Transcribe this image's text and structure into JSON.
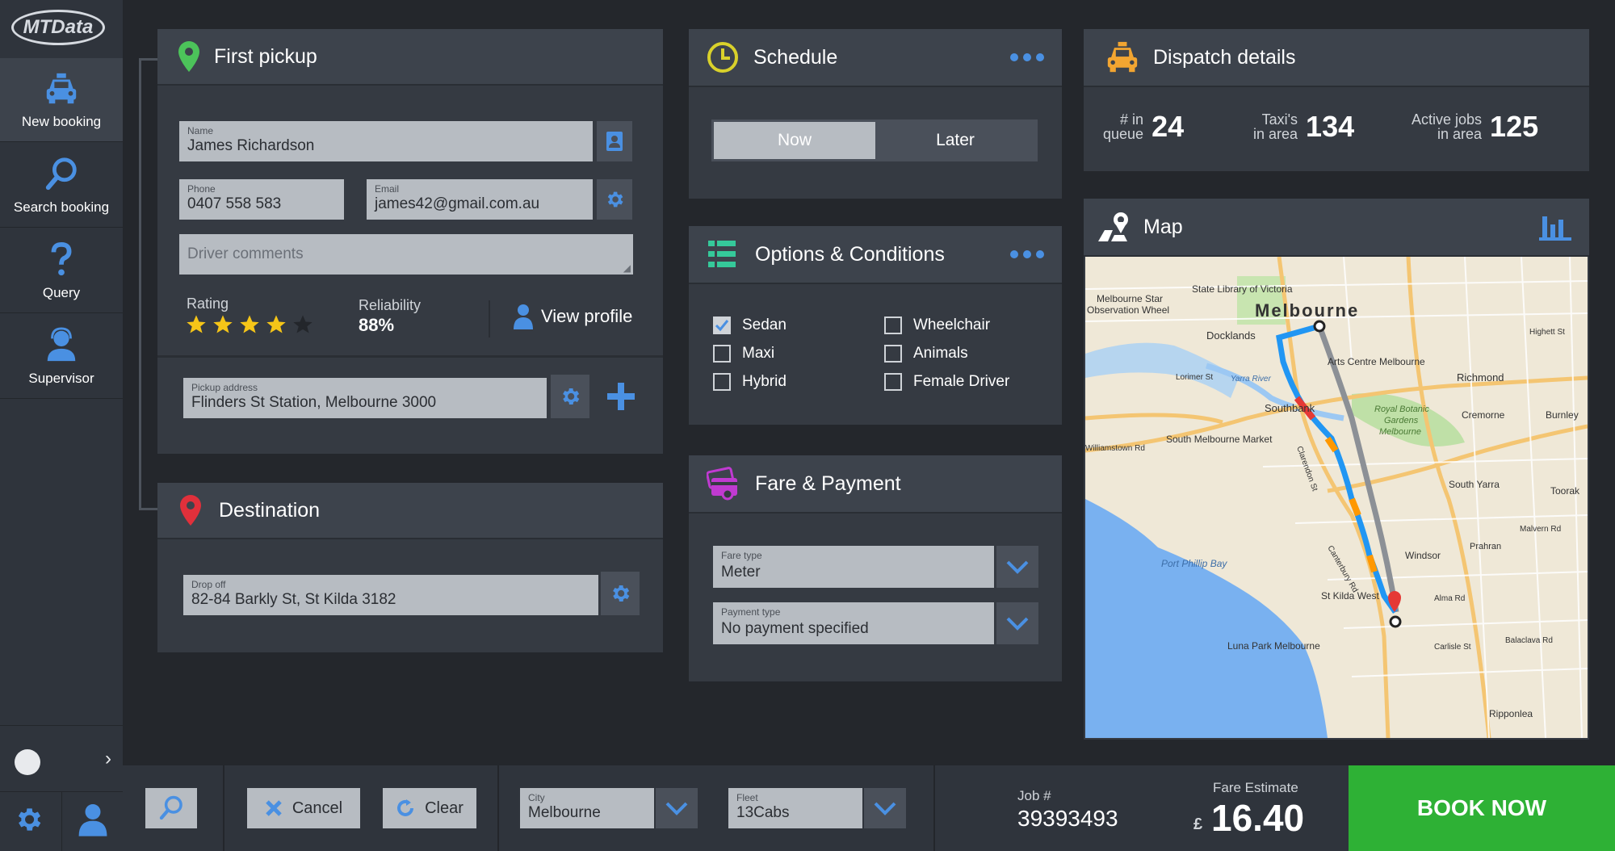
{
  "sidebar": {
    "logo": "MTData",
    "items": [
      {
        "label": "New booking",
        "icon": "taxi-icon"
      },
      {
        "label": "Search booking",
        "icon": "search-icon"
      },
      {
        "label": "Query",
        "icon": "question-icon"
      },
      {
        "label": "Supervisor",
        "icon": "supervisor-icon"
      }
    ]
  },
  "pickup": {
    "title": "First pickup",
    "name_label": "Name",
    "name_value": "James Richardson",
    "phone_label": "Phone",
    "phone_value": "0407 558 583",
    "email_label": "Email",
    "email_value": "james42@gmail.com.au",
    "comments_placeholder": "Driver comments",
    "rating_label": "Rating",
    "rating_stars": 4,
    "rating_max": 5,
    "reliability_label": "Reliability",
    "reliability_value": "88%",
    "view_profile": "View profile",
    "address_label": "Pickup address",
    "address_value": "Flinders St Station, Melbourne 3000"
  },
  "destination": {
    "title": "Destination",
    "dropoff_label": "Drop off",
    "dropoff_value": "82-84 Barkly St, St Kilda 3182"
  },
  "schedule": {
    "title": "Schedule",
    "now": "Now",
    "later": "Later",
    "selected": "Now"
  },
  "options": {
    "title": "Options & Conditions",
    "items": [
      {
        "label": "Sedan",
        "checked": true
      },
      {
        "label": "Maxi",
        "checked": false
      },
      {
        "label": "Hybrid",
        "checked": false
      },
      {
        "label": "Wheelchair",
        "checked": false
      },
      {
        "label": "Animals",
        "checked": false
      },
      {
        "label": "Female Driver",
        "checked": false
      }
    ]
  },
  "fare": {
    "title": "Fare & Payment",
    "fare_type_label": "Fare type",
    "fare_type_value": "Meter",
    "payment_type_label": "Payment type",
    "payment_type_value": "No payment specified"
  },
  "dispatch": {
    "title": "Dispatch details",
    "queue_label_1": "# in",
    "queue_label_2": "queue",
    "queue_value": "24",
    "taxis_label_1": "Taxi's",
    "taxis_label_2": "in area",
    "taxis_value": "134",
    "jobs_label_1": "Active jobs",
    "jobs_label_2": "in area",
    "jobs_value": "125"
  },
  "map": {
    "title": "Map",
    "labels": {
      "melbourne": "Melbourne",
      "state_library": "State Library of Victoria",
      "star": "Melbourne Star",
      "wheel": "Observation Wheel",
      "docklands": "Docklands",
      "arts": "Arts Centre Melbourne",
      "richmond": "Richmond",
      "southbank": "Southbank",
      "botanic1": "Royal Botanic",
      "botanic2": "Gardens",
      "botanic3": "Melbourne",
      "cremorne": "Cremorne",
      "burnley": "Burnley",
      "smm": "South Melbourne Market",
      "williamstown": "Williamstown Rd",
      "south_yarra": "South Yarra",
      "toorak": "Toorak",
      "windsor": "Windsor",
      "prahran": "Prahran",
      "port_phillip": "Port Phillip Bay",
      "st_kilda_west": "St Kilda West",
      "luna_park": "Luna Park Melbourne",
      "ripponlea": "Ripponlea",
      "alma": "Alma Rd",
      "balaclava": "Balaclava Rd",
      "carlisle": "Carlisle St",
      "malvern": "Malvern Rd",
      "highett": "Highett St",
      "yarra": "Yarra River",
      "lorimer": "Lorimer St",
      "clarendon": "Clarendon St",
      "canterbury": "Canterbury Rd"
    }
  },
  "bottom": {
    "cancel": "Cancel",
    "clear": "Clear",
    "city_label": "City",
    "city_value": "Melbourne",
    "fleet_label": "Fleet",
    "fleet_value": "13Cabs",
    "job_label": "Job #",
    "job_value": "39393493",
    "fare_estimate_label": "Fare Estimate",
    "currency": "£",
    "fare_estimate_value": "16.40",
    "book_now": "BOOK NOW"
  },
  "colors": {
    "accent_blue": "#4a90e2",
    "book_green": "#2eb135",
    "pin_green": "#4cc35a",
    "pin_red": "#e0303b",
    "clock_yellow": "#d9d12b",
    "taxi_orange": "#f2a531",
    "list_teal": "#35c99a",
    "payment_purple": "#c03ad1",
    "star_yellow": "#f5c518"
  }
}
